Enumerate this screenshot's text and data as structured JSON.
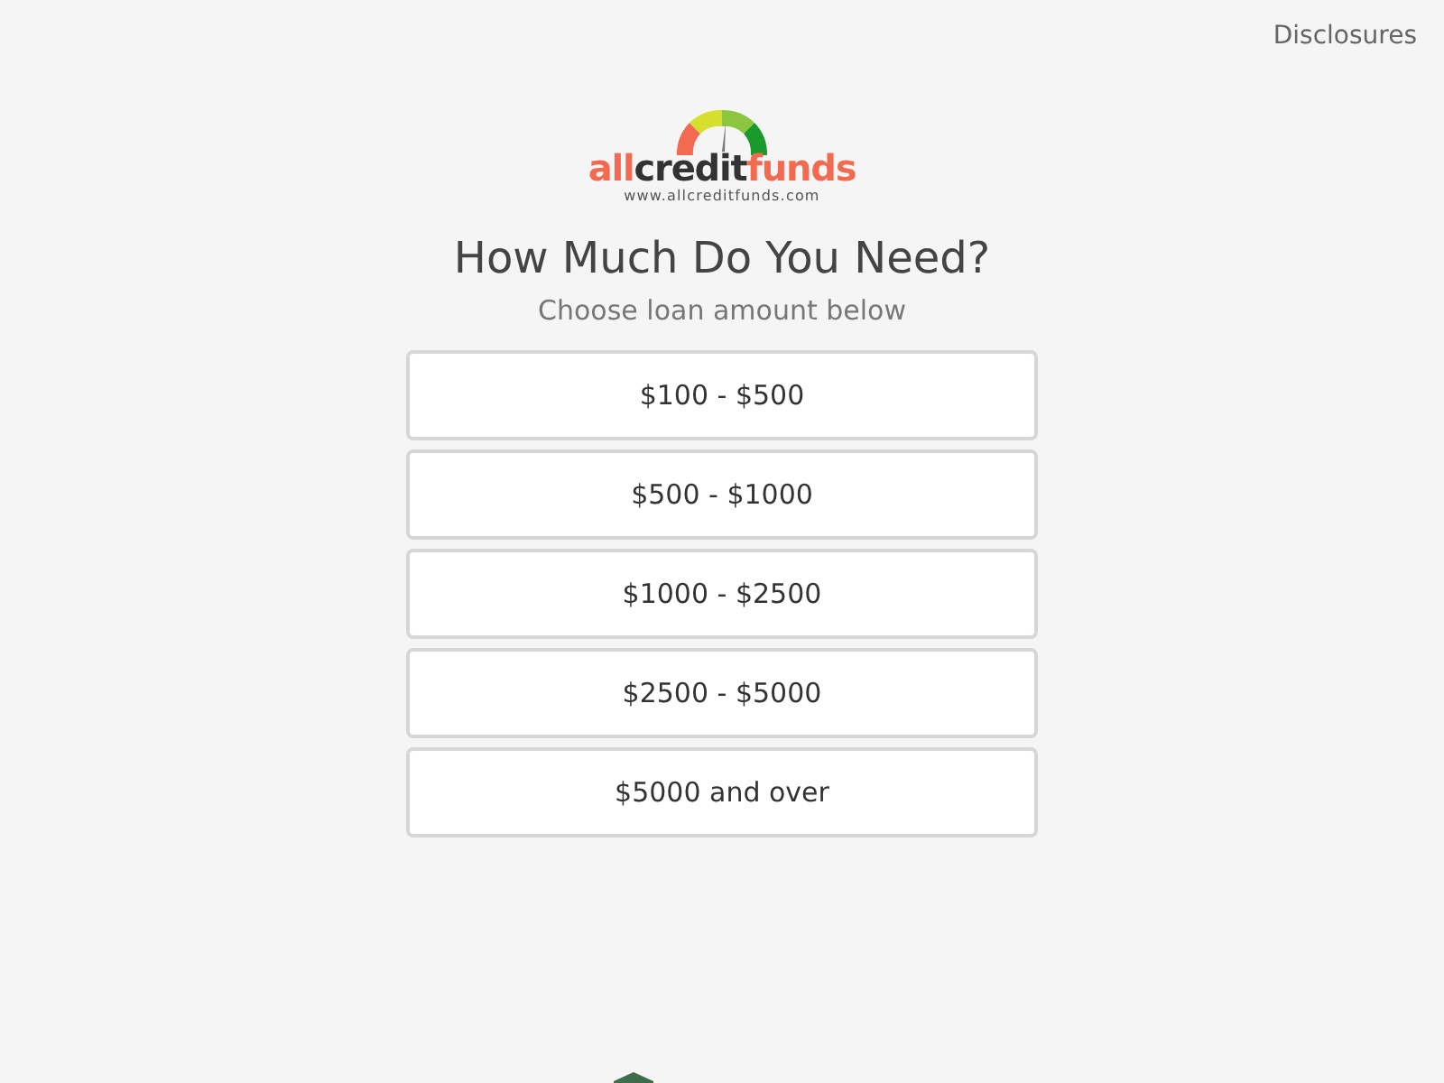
{
  "header": {
    "link": "Disclosures"
  },
  "logo": {
    "parts": [
      {
        "text": "all",
        "color": "#f26b50"
      },
      {
        "text": "credit",
        "color": "#333333"
      },
      {
        "text": "funds",
        "color": "#f26b50"
      }
    ],
    "url": "www.allcreditfunds.com"
  },
  "title": "How Much Do You Need?",
  "subtitle": "Choose loan amount below",
  "options": [
    {
      "label": "$100 - $500"
    },
    {
      "label": "$500 - $1000"
    },
    {
      "label": "$1000 - $2500"
    },
    {
      "label": "$2500 - $5000"
    },
    {
      "label": "$5000 and over"
    }
  ]
}
